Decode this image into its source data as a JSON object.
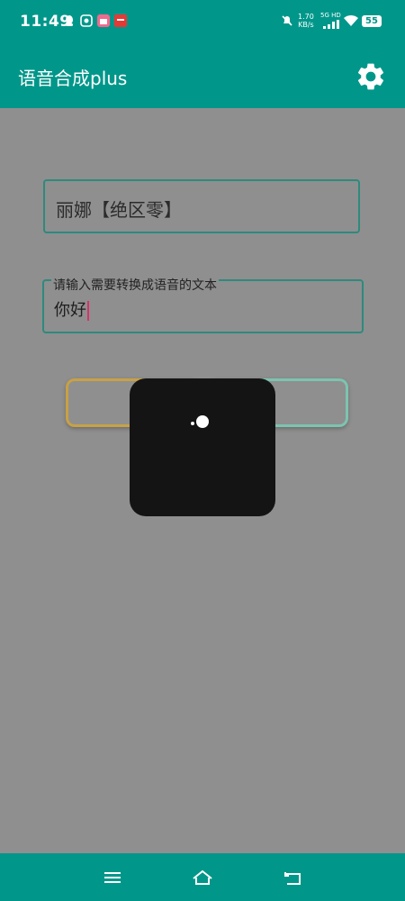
{
  "status_bar": {
    "time": "11:49",
    "network_speed_value": "1.70",
    "network_speed_unit": "KB/s",
    "network_type": "5G HD",
    "battery": "55",
    "icons": [
      "qq-icon",
      "app-icon",
      "shopping-icon",
      "news-icon",
      "mute-icon",
      "signal-icon",
      "wifi-icon",
      "battery-icon"
    ]
  },
  "app_bar": {
    "title": "语音合成plus",
    "settings_icon": "gear-icon"
  },
  "voice_select": {
    "value": "丽娜【绝区零】"
  },
  "text_input": {
    "label": "请输入需要转换成语音的文本",
    "value": "你好"
  },
  "buttons": {
    "left_label": "",
    "right_label": ""
  },
  "loading_dialog": {
    "icon": "spinner-icon"
  },
  "nav_bar": {
    "icons": [
      "menu-icon",
      "home-icon",
      "back-icon"
    ]
  },
  "colors": {
    "primary": "#00978a",
    "overlay": "#8f8f8f",
    "field_border": "#2e8a7d",
    "button_left_border": "#c8a145",
    "button_right_border": "#7cc4b0",
    "dialog": "#141414",
    "caret": "#d6336c"
  }
}
